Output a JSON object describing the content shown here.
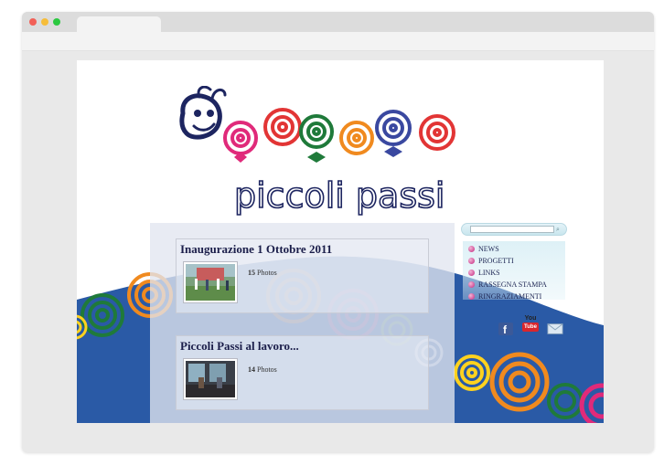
{
  "site": {
    "logo_text": "piccoli passi"
  },
  "albums": [
    {
      "title": "Inaugurazione 1 Ottobre 2011",
      "count": "15",
      "count_label": "Photos"
    },
    {
      "title": "Piccoli Passi al lavoro...",
      "count": "14",
      "count_label": "Photos"
    }
  ],
  "search": {
    "icon": "search-icon"
  },
  "menu": {
    "items": [
      {
        "label": "NEWS"
      },
      {
        "label": "PROGETTI"
      },
      {
        "label": "LINKS"
      },
      {
        "label": "RASSEGNA STAMPA"
      },
      {
        "label": "RINGRAZIAMENTI"
      }
    ]
  },
  "social": {
    "facebook_icon": "facebook-icon",
    "youtube_label_1": "You",
    "youtube_label_2": "Tube",
    "email_icon": "email-icon"
  },
  "colors": {
    "page_blue": "#2a5aa6",
    "title_navy": "#1b1e4a",
    "bullet_pink": "#c2267e"
  }
}
